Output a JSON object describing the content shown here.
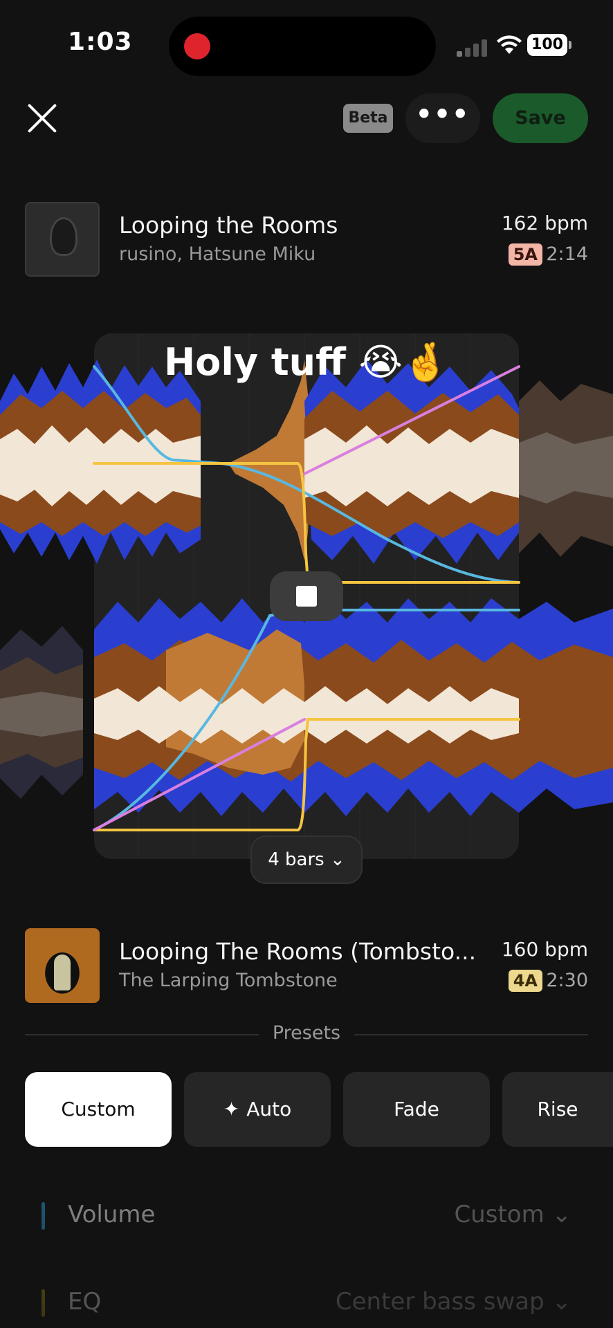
{
  "status_bar": {
    "time": "1:03",
    "battery": "100"
  },
  "top_bar": {
    "beta_label": "Beta",
    "more_label": "•••",
    "save_label": "Save"
  },
  "track_a": {
    "title": "Looping the Rooms",
    "artist": "rusino, Hatsune Miku",
    "bpm": "162 bpm",
    "key": "5A",
    "duration": "2:14"
  },
  "track_b": {
    "title": "Looping The Rooms (Tombsto...",
    "artist": "The Larping Tombstone",
    "bpm": "160 bpm",
    "key": "4A",
    "duration": "2:30"
  },
  "mixer": {
    "caption": "Holy tuff 😭🤞",
    "length_label": "4 bars ⌄"
  },
  "presets": {
    "label": "Presets",
    "items": [
      {
        "label": "Custom",
        "active": true
      },
      {
        "label": "Auto",
        "icon": "sparkle-icon"
      },
      {
        "label": "Fade"
      },
      {
        "label": "Rise"
      }
    ]
  },
  "settings": [
    {
      "label": "Volume",
      "value": "Custom ⌄",
      "color": "#1f5a78"
    },
    {
      "label": "EQ",
      "value": "Center bass swap ⌄",
      "color": "#6b5a14"
    }
  ],
  "colors": {
    "save_bg": "#1b5a2a",
    "volume_curve": "#58b8e0",
    "eq_curve": "#f5c542",
    "filter_curve": "#d97fe0",
    "wave_blue": "#2a3fd0",
    "wave_brown": "#8a4a1c",
    "wave_orange": "#c07a36",
    "wave_cream": "#f2e6d6"
  }
}
